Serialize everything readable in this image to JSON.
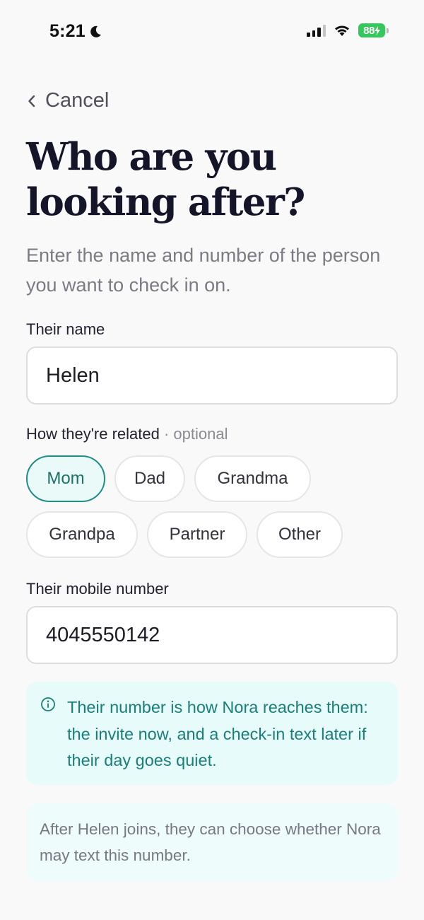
{
  "status_bar": {
    "time": "5:21",
    "battery": "88"
  },
  "header": {
    "back_label": "Cancel",
    "title": "Who are you looking after?",
    "subtitle": "Enter the name and number of the person you want to check in on."
  },
  "form": {
    "name_label": "Their name",
    "name_value": "Helen",
    "relation_label": "How they're related",
    "relation_optional": " · optional",
    "relations": [
      "Mom",
      "Dad",
      "Grandma",
      "Grandpa",
      "Partner",
      "Other"
    ],
    "selected_relation": "Mom",
    "phone_label": "Their mobile number",
    "phone_value": "4045550142"
  },
  "info": {
    "text": "Their number is how Nora reaches them: the invite now, and a check-in text later if their day goes quiet."
  },
  "note": {
    "text": "After Helen joins, they can choose whether Nora may text this number."
  },
  "colors": {
    "accent": "#1f8f86",
    "info_bg": "#e7fbfa",
    "battery": "#34c759"
  }
}
